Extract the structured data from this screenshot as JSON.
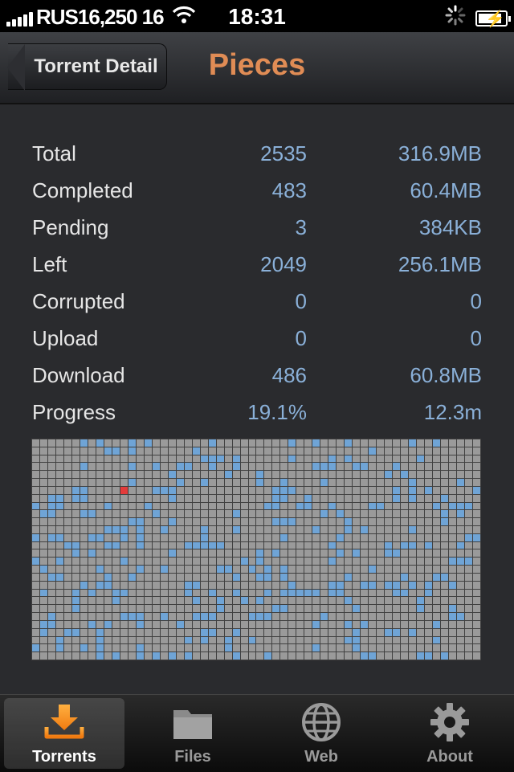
{
  "status_bar": {
    "carrier": "RUS16,250 16",
    "time": "18:31"
  },
  "nav": {
    "back_label": "Torrent Detail",
    "title": "Pieces",
    "title_color": "#e08c55"
  },
  "stats": [
    {
      "label": "Total",
      "count": "2535",
      "size": "316.9MB"
    },
    {
      "label": "Completed",
      "count": "483",
      "size": "60.4MB"
    },
    {
      "label": "Pending",
      "count": "3",
      "size": "384KB"
    },
    {
      "label": "Left",
      "count": "2049",
      "size": "256.1MB"
    },
    {
      "label": "Corrupted",
      "count": "0",
      "size": "0"
    },
    {
      "label": "Upload",
      "count": "0",
      "size": "0"
    },
    {
      "label": "Download",
      "count": "486",
      "size": "60.8MB"
    },
    {
      "label": "Progress",
      "count": "19.1%",
      "size": "12.3m"
    }
  ],
  "piece_map": {
    "total": 2535,
    "completed": 483,
    "pending": 3,
    "colors": {
      "empty": "#9a9a9a",
      "completed": "#6fa4d6",
      "pending": "#e33b3b",
      "grid": "#404040"
    }
  },
  "tabs": [
    {
      "label": "Torrents",
      "icon": "download-tray-icon",
      "selected": true
    },
    {
      "label": "Files",
      "icon": "folder-icon",
      "selected": false
    },
    {
      "label": "Web",
      "icon": "globe-icon",
      "selected": false
    },
    {
      "label": "About",
      "icon": "gear-icon",
      "selected": false
    }
  ]
}
